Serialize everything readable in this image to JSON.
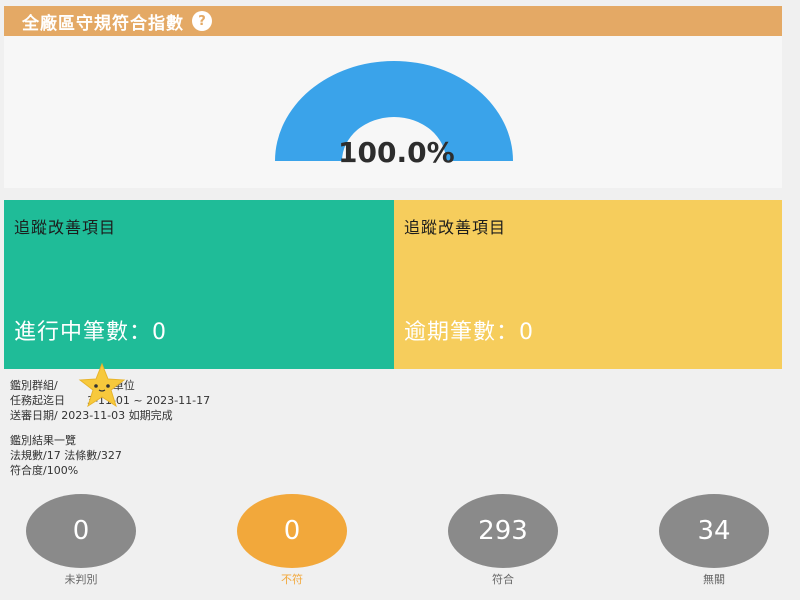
{
  "header": {
    "title": "全廠區守規符合指數",
    "help_symbol": "?"
  },
  "gauge": {
    "value_label": "100.0%",
    "percent": 100,
    "color": "#3aa3ea"
  },
  "cards": [
    {
      "title": "追蹤改善項目",
      "count_label": "進行中筆數：0",
      "color": "#1fbc98"
    },
    {
      "title": "追蹤改善項目",
      "count_label": "逾期筆數：0",
      "color": "#f6cd5c"
    }
  ],
  "info": {
    "line1": "鑑別群組/　　　環保單位",
    "line2": "任務起迄日　　3-11-01 ~ 2023-11-17",
    "line3": "送審日期/ 2023-11-03 如期完成",
    "line4": "鑑別結果一覽",
    "line5": "法規數/17 法條數/327",
    "line6": "符合度/100%"
  },
  "stats": [
    {
      "value": "0",
      "label": "未判別",
      "color": "#8a8a8a"
    },
    {
      "value": "0",
      "label": "不符",
      "color": "#f2a83b"
    },
    {
      "value": "293",
      "label": "符合",
      "color": "#8a8a8a"
    },
    {
      "value": "34",
      "label": "無關",
      "color": "#8a8a8a"
    }
  ],
  "colors": {
    "header_bg": "#e4a965",
    "green": "#1fbc98",
    "yellow": "#f6cd5c",
    "gauge_blue": "#3aa3ea",
    "stat_gray": "#8a8a8a",
    "stat_orange": "#f2a83b"
  },
  "icons": [
    "help-icon",
    "star-mascot-icon"
  ]
}
